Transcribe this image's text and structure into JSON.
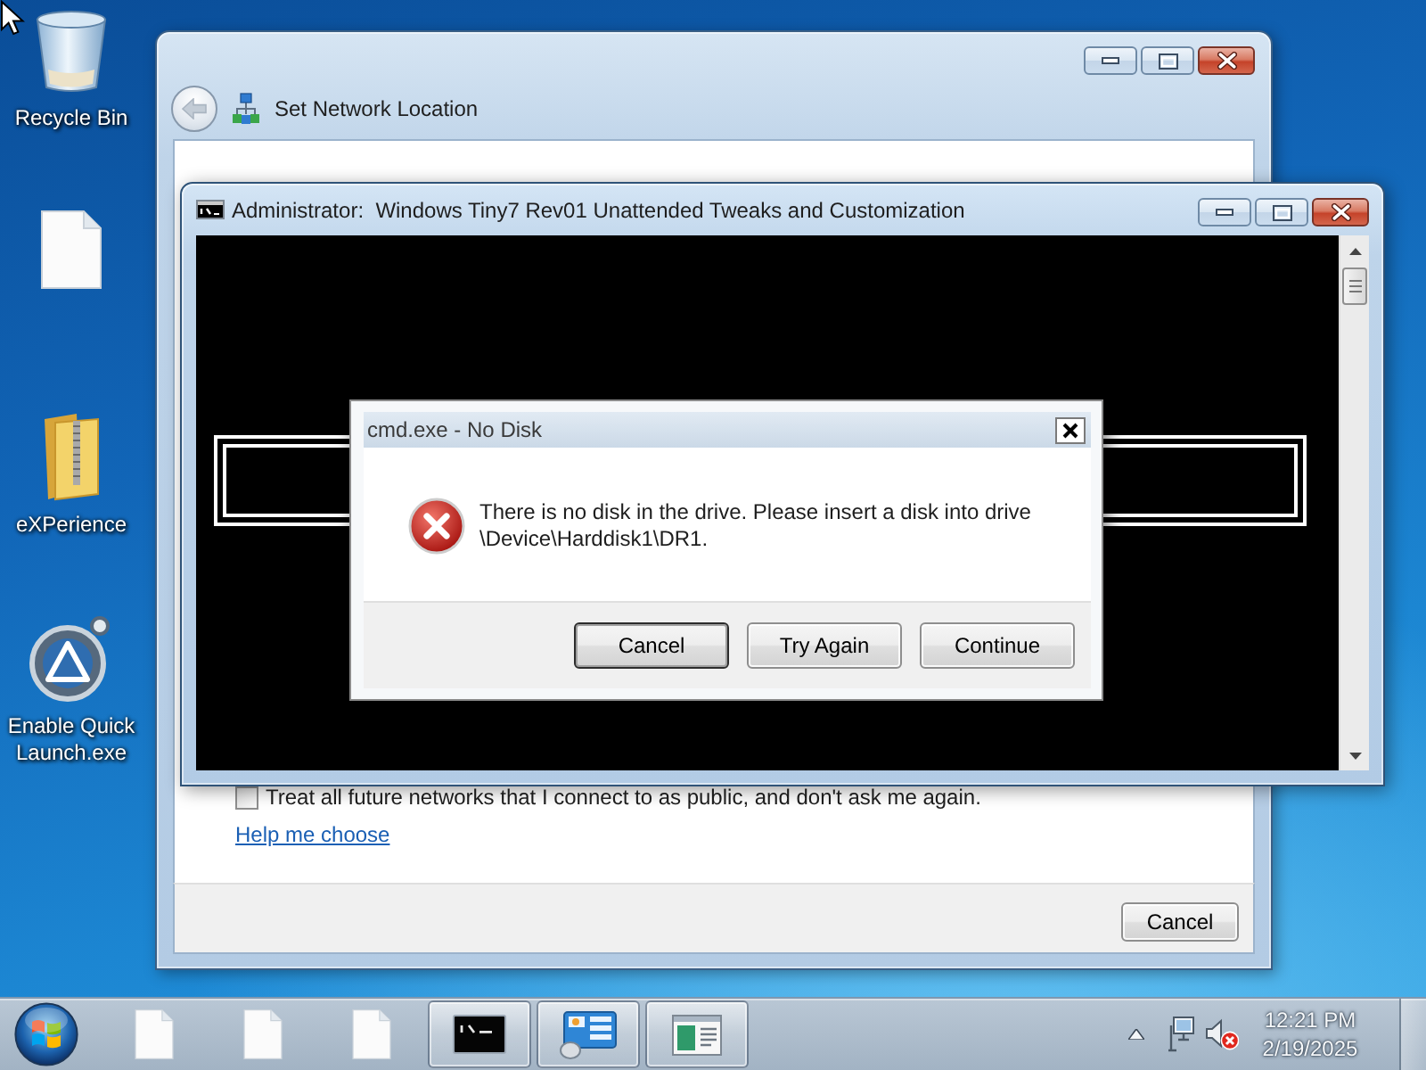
{
  "desktop": {
    "icons": [
      {
        "kind": "recycle-bin",
        "label": "Recycle Bin"
      },
      {
        "kind": "file"
      },
      {
        "kind": "zip-folder",
        "label": "eXPerience"
      },
      {
        "kind": "app",
        "label": "Enable Quick Launch.exe"
      }
    ]
  },
  "network_window": {
    "title": "Set Network Location",
    "back_button": {
      "disabled": true
    },
    "checkbox": {
      "label": "Treat all future networks that I connect to as public, and don't ask me again.",
      "checked": false
    },
    "link": "Help me choose",
    "buttons": [
      "Cancel"
    ]
  },
  "console_window": {
    "title": "Administrator:  Windows Tiny7 Rev01 Unattended Tweaks and Customization"
  },
  "dialog": {
    "kind": "error",
    "title": "cmd.exe - No Disk",
    "message": "There is no disk in the drive. Please insert a disk into drive \\Device\\Harddisk1\\DR1.",
    "buttons": [
      {
        "label": "Cancel",
        "default": true
      },
      {
        "label": "Try Again",
        "default": false
      },
      {
        "label": "Continue",
        "default": false
      }
    ]
  },
  "taskbar": {
    "items": [
      {
        "kind": "file",
        "running": false
      },
      {
        "kind": "file",
        "running": false
      },
      {
        "kind": "file",
        "running": false
      },
      {
        "kind": "console",
        "running": true
      },
      {
        "kind": "control-panel",
        "running": true
      },
      {
        "kind": "window",
        "running": true
      }
    ],
    "tray": {
      "volume_muted": true,
      "time": "12:21 PM",
      "date": "2/19/2025"
    }
  }
}
